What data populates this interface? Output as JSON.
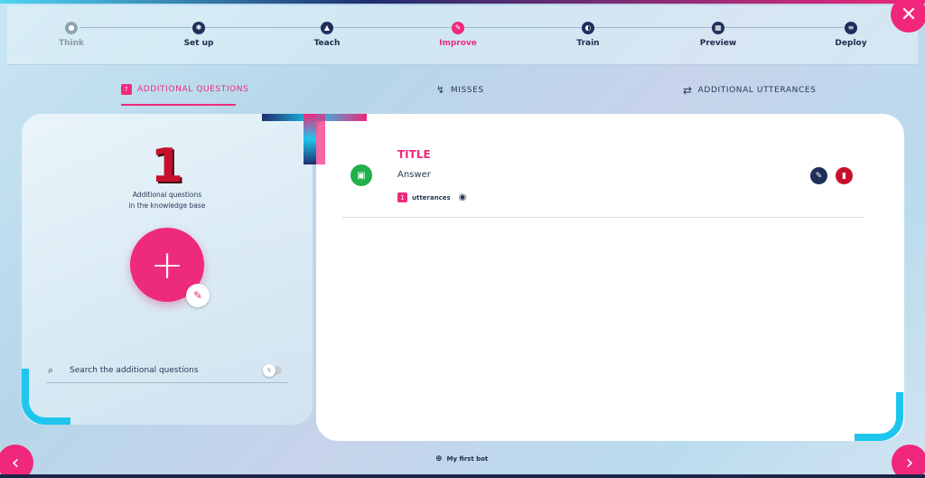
{
  "stepper": {
    "steps": [
      {
        "label": "Think",
        "state": "done",
        "icon": "lightbulb-icon"
      },
      {
        "label": "Set up",
        "state": "normal",
        "icon": "gear-icon"
      },
      {
        "label": "Teach",
        "state": "normal",
        "icon": "graduation-cap-icon"
      },
      {
        "label": "Improve",
        "state": "active",
        "icon": "pencil-icon"
      },
      {
        "label": "Train",
        "state": "normal",
        "icon": "brain-icon"
      },
      {
        "label": "Preview",
        "state": "normal",
        "icon": "calendar-icon"
      },
      {
        "label": "Deploy",
        "state": "normal",
        "icon": "server-icon"
      }
    ]
  },
  "tabs": [
    {
      "label": "ADDITIONAL QUESTIONS",
      "icon": "question-book-icon",
      "active": true
    },
    {
      "label": "MISSES",
      "icon": "misses-check-icon",
      "active": false
    },
    {
      "label": "ADDITIONAL UTTERANCES",
      "icon": "repeat-icon",
      "active": false
    }
  ],
  "summary": {
    "count": "1",
    "caption_line1": "Additional questions",
    "caption_line2": "in the knowledge base"
  },
  "search": {
    "placeholder": "Search the additional questions"
  },
  "question": {
    "title": "TITLE",
    "answer": "Answer",
    "utterance_count": "1",
    "utterance_label": "utterances"
  },
  "footer": {
    "bot_name": "My first bot"
  },
  "colors": {
    "accent": "#ee2a7b",
    "navy": "#1e2f5c",
    "cyan": "#1ec6ee",
    "danger": "#c8102e",
    "success": "#22b04b"
  }
}
